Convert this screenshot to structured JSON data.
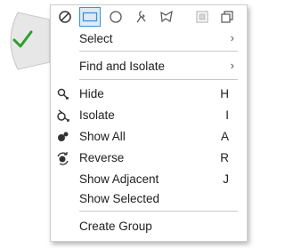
{
  "toolbar": {
    "tools": [
      {
        "icon": "none-select-icon",
        "active": false
      },
      {
        "icon": "rectangle-select-icon",
        "active": true
      },
      {
        "icon": "circle-select-icon",
        "active": false
      },
      {
        "icon": "lasso-select-icon",
        "active": false
      },
      {
        "icon": "polygon-select-icon",
        "active": false
      },
      {
        "icon": "frame-icon",
        "active": false
      },
      {
        "icon": "copy-icon",
        "active": false
      }
    ]
  },
  "menu": {
    "select": {
      "label": "Select",
      "arrow": "›"
    },
    "find_isolate": {
      "label": "Find and Isolate",
      "arrow": "›"
    },
    "hide": {
      "label": "Hide",
      "shortcut": "H"
    },
    "isolate": {
      "label": "Isolate",
      "shortcut": "I"
    },
    "show_all": {
      "label": "Show All",
      "shortcut": "A"
    },
    "reverse": {
      "label": "Reverse",
      "shortcut": "R"
    },
    "show_adjacent": {
      "label": "Show Adjacent",
      "shortcut": "J"
    },
    "show_selected": {
      "label": "Show Selected"
    },
    "create_group": {
      "label": "Create Group"
    }
  },
  "colors": {
    "accent": "#3a8fd8",
    "check": "#2e9e2e"
  }
}
